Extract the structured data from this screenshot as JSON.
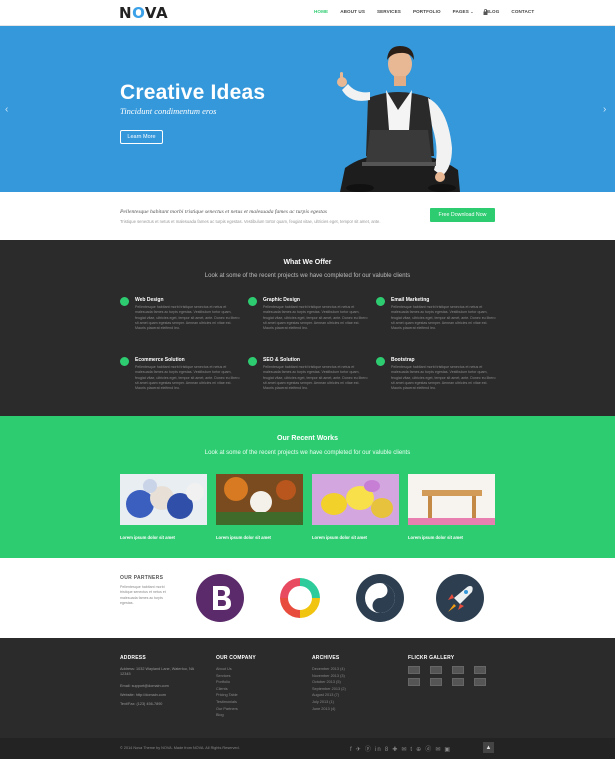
{
  "brand": {
    "name_start": "N",
    "name_o": "O",
    "name_end": "VA"
  },
  "nav": {
    "items": [
      "HOME",
      "ABOUT US",
      "SERVICES",
      "PORTFOLIO",
      "PAGES",
      "BLOG",
      "CONTACT"
    ],
    "pages_caret": "⌄"
  },
  "hero": {
    "title": "Creative Ideas",
    "subtitle": "Tincidunt condimentum eros",
    "button": "Learn More",
    "prev": "‹",
    "next": "›"
  },
  "cta": {
    "headline": "Pellentesque habitant morbi tristique senectus et netus et malesuada fames ac turpis egestas",
    "text": "Tristique senectus et netus et malesuada fames ac turpis egestas. Vestibulum tortor quam, feugiat vitae, ultricies eget, tempor sit amet, ante.",
    "button": "Free Download Now"
  },
  "offer": {
    "title": "What We Offer",
    "subtitle": "Look at some of the recent projects we have completed for our valuble clients",
    "services": [
      {
        "title": "Web Design",
        "text": "Pellentesque habitant morbi tristique senectus et netus et malesuada fames ac turpis egestas. Vestibulum tortor quam, feugiat vitae, ultricies eget, tempor sit amet, ante. Donec eu libero sit amet quam egestas semper. Aenean ultricies mi vitae est. Mauris placerat eleifend leo."
      },
      {
        "title": "Graphic Design",
        "text": "Pellentesque habitant morbi tristique senectus et netus et malesuada fames ac turpis egestas. Vestibulum tortor quam, feugiat vitae, ultricies eget, tempor sit amet, ante. Donec eu libero sit amet quam egestas semper. Aenean ultricies mi vitae est. Mauris placerat eleifend leo."
      },
      {
        "title": "Email Marketing",
        "text": "Pellentesque habitant morbi tristique senectus et netus et malesuada fames ac turpis egestas. Vestibulum tortor quam, feugiat vitae, ultricies eget, tempor sit amet, ante. Donec eu libero sit amet quam egestas semper. Aenean ultricies mi vitae est. Mauris placerat eleifend leo."
      },
      {
        "title": "Ecommerce Solution",
        "text": "Pellentesque habitant morbi tristique senectus et netus et malesuada fames ac turpis egestas. Vestibulum tortor quam, feugiat vitae, ultricies eget, tempor sit amet, ante. Donec eu libero sit amet quam egestas semper. Aenean ultricies mi vitae est. Mauris placerat eleifend leo."
      },
      {
        "title": "SEO & Solution",
        "text": "Pellentesque habitant morbi tristique senectus et netus et malesuada fames ac turpis egestas. Vestibulum tortor quam, feugiat vitae, ultricies eget, tempor sit amet, ante. Donec eu libero sit amet quam egestas semper. Aenean ultricies mi vitae est. Mauris placerat eleifend leo."
      },
      {
        "title": "Bootstrap",
        "text": "Pellentesque habitant morbi tristique senectus et netus et malesuada fames ac turpis egestas. Vestibulum tortor quam, feugiat vitae, ultricies eget, tempor sit amet, ante. Donec eu libero sit amet quam egestas semper. Aenean ultricies mi vitae est. Mauris placerat eleifend leo."
      }
    ]
  },
  "works": {
    "title": "Our Recent Works",
    "subtitle": "Look at some of the recent projects we have completed for our valuble clients",
    "items": [
      {
        "caption": "Lorem ipsum dolor sit amet"
      },
      {
        "caption": "Lorem ipsum dolor sit amet"
      },
      {
        "caption": "Lorem ipsum dolor sit amet"
      },
      {
        "caption": "Lorem ipsum dolor sit amet"
      }
    ]
  },
  "partners": {
    "title": "OUR PARTNERS",
    "text": "Pellentesque habitant morbi tristique senectus et netus et malesuada fames ac turpis egestas."
  },
  "footer": {
    "address": {
      "title": "ADDRESS",
      "lines": [
        "Address: 1032 Wayland Lane, Waterloo, NA 12345",
        "Email: support@domain.com",
        "Website: http://domain.com",
        "Text/Fax: (123) 456-7890"
      ]
    },
    "company": {
      "title": "OUR COMPANY",
      "links": [
        "About Us",
        "Services",
        "Portfolio",
        "Clients",
        "Pricing Table",
        "Testimonials",
        "Our Partners",
        "Blog"
      ]
    },
    "archives": {
      "title": "ARCHIVES",
      "links": [
        "December 2013 (4)",
        "November 2013 (3)",
        "October 2013 (5)",
        "September 2013 (2)",
        "August 2013 (7)",
        "July 2013 (1)",
        "June 2013 (4)"
      ]
    },
    "flickr": {
      "title": "FLICKR GALLERY"
    },
    "copyright": "© 2014 Nova Theme by NOVA. Made from NOVA. All Rights Reserved.",
    "social": "f ✈ ⓟ in 8 ✚ ✉ t ⊕ ⓓ ✉ ▣",
    "to_top": "▲"
  }
}
